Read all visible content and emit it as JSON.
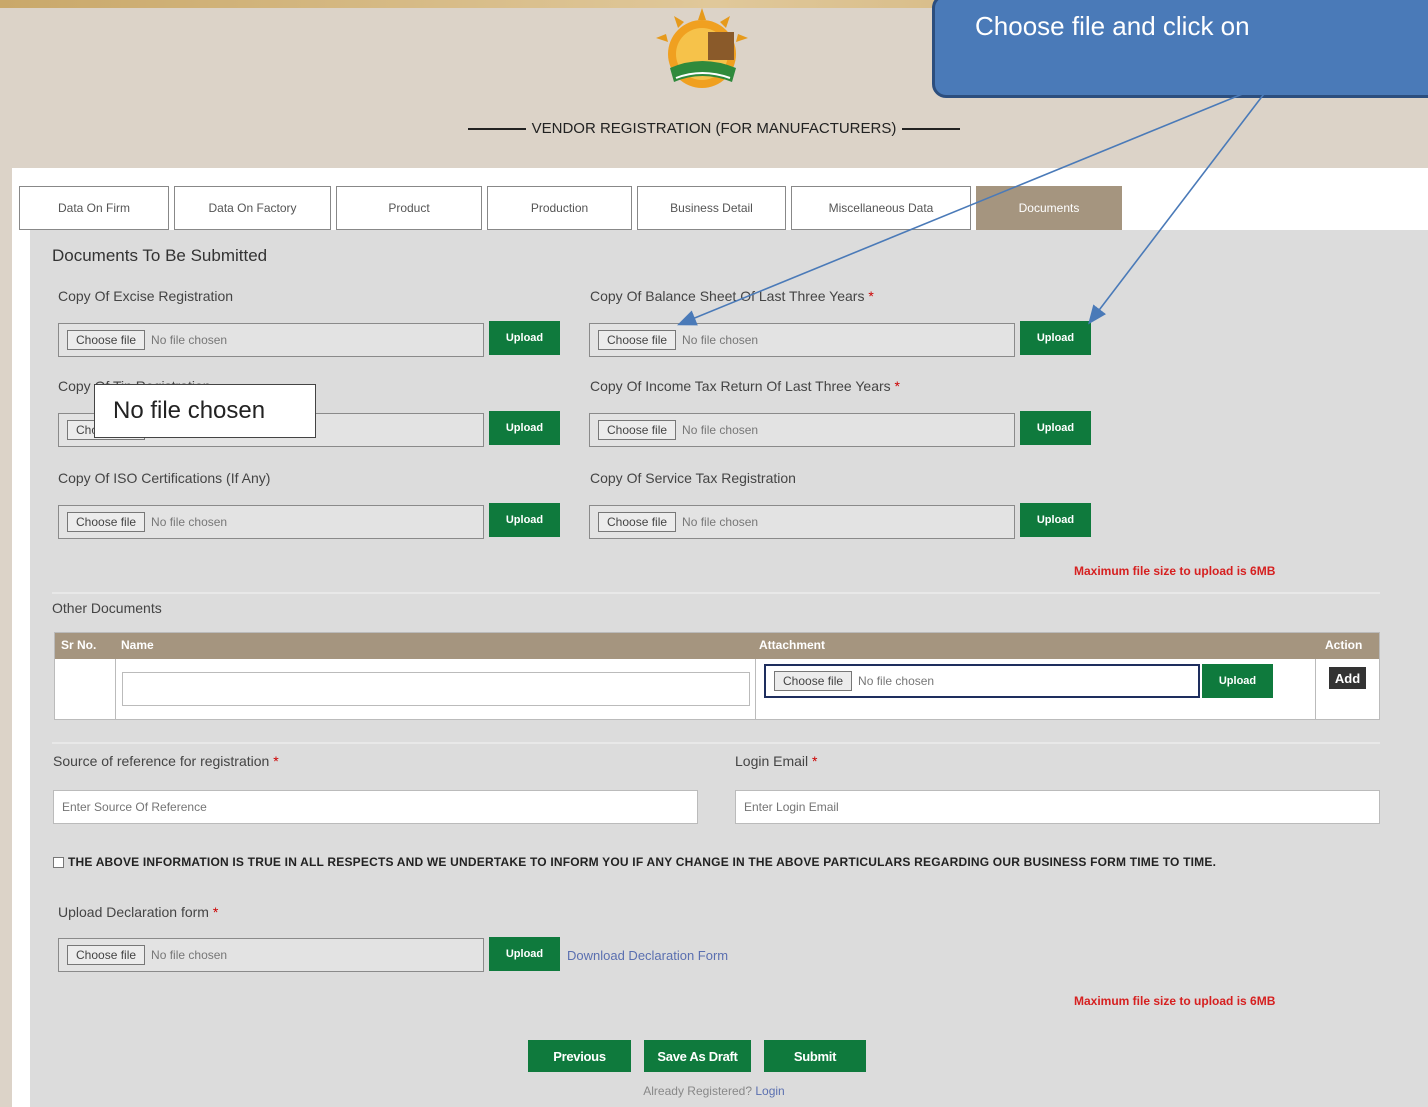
{
  "header": {
    "title": "VENDOR REGISTRATION (FOR MANUFACTURERS)",
    "logo_icon": "logo-emblem"
  },
  "tabs": [
    {
      "label": "Data On Firm"
    },
    {
      "label": "Data On Factory"
    },
    {
      "label": "Product"
    },
    {
      "label": "Production"
    },
    {
      "label": "Business Detail"
    },
    {
      "label": "Miscellaneous Data"
    },
    {
      "label": "Documents",
      "active": true
    }
  ],
  "documents": {
    "heading": "Documents To Be Submitted",
    "excise_label": "Copy Of Excise Registration",
    "balance_label": "Copy Of Balance Sheet Of Last Three Years",
    "tin_label": "Copy Of Tin Registration",
    "income_label": "Copy Of Income Tax Return Of Last Three Years",
    "iso_label": "Copy Of ISO Certifications (If Any)",
    "service_label": "Copy Of Service Tax Registration",
    "required_mark": "*",
    "choose_label": "Choose file",
    "no_file": "No file chosen",
    "upload_label": "Upload",
    "max_size": "Maximum file size to upload is 6MB"
  },
  "other_docs": {
    "heading": "Other Documents",
    "columns": {
      "sr": "Sr No.",
      "name": "Name",
      "attachment": "Attachment",
      "action": "Action"
    },
    "add_label": "Add"
  },
  "reference": {
    "label": "Source of reference for registration",
    "placeholder": "Enter Source Of Reference"
  },
  "login_email": {
    "label": "Login Email",
    "placeholder": "Enter Login Email"
  },
  "declaration": {
    "text": "THE ABOVE INFORMATION IS TRUE IN ALL RESPECTS AND WE UNDERTAKE TO INFORM YOU IF ANY CHANGE IN THE ABOVE PARTICULARS REGARDING OUR BUSINESS FORM TIME TO TIME.",
    "upload_label": "Upload Declaration form",
    "download_link": "Download Declaration Form"
  },
  "buttons": {
    "previous": "Previous",
    "save_draft": "Save As Draft",
    "submit": "Submit"
  },
  "footer": {
    "already": "Already Registered?",
    "login": "Login"
  },
  "tooltip": "No file chosen",
  "callout": "Choose file and click on",
  "colors": {
    "upload_green": "#0f7a3d",
    "tab_active": "#a5957f",
    "callout_blue": "#4a7ab8",
    "warning_red": "#d62020"
  }
}
